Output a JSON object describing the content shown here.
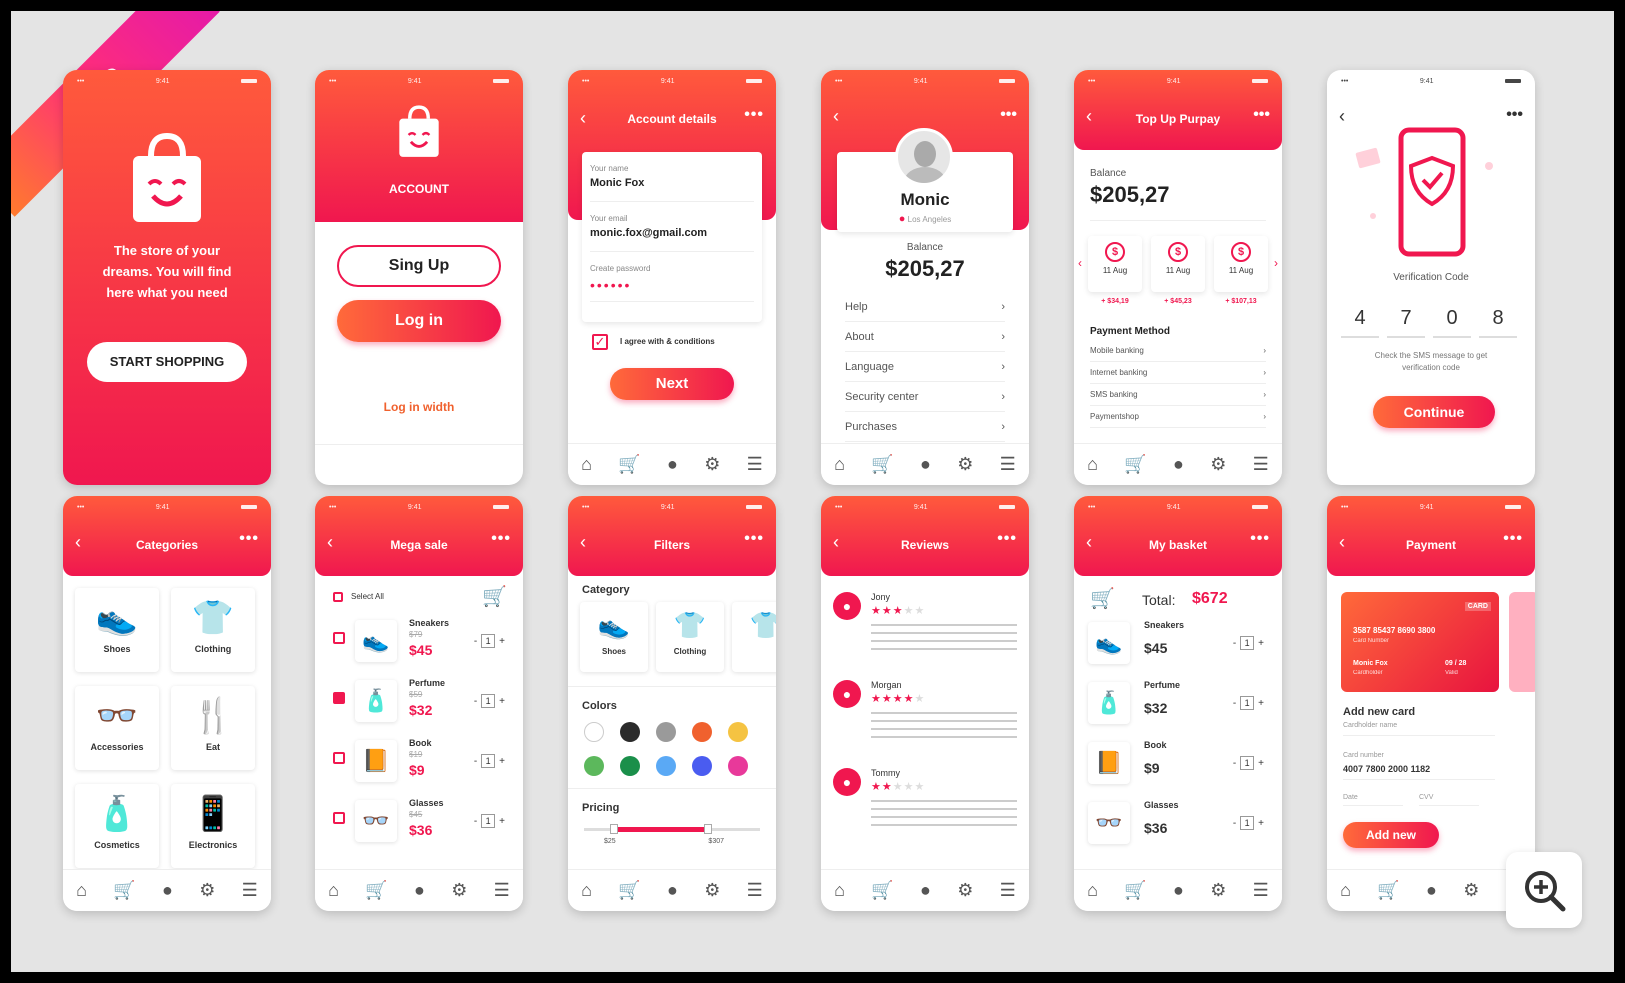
{
  "ribbon": "Pro",
  "nav_icons": [
    "store-icon",
    "cart-icon",
    "user-icon",
    "gear-icon",
    "menu-icon"
  ],
  "welcome": {
    "tagline": "The store of your dreams. You will find here what you need",
    "start_button": "START SHOPPING"
  },
  "account": {
    "title": "ACCOUNT",
    "signup_button": "Sing Up",
    "login_button": "Log in",
    "login_with": "Log in width"
  },
  "account_details": {
    "title": "Account details",
    "name_label": "Your name",
    "name_value": "Monic Fox",
    "email_label": "Your email",
    "email_value": "monic.fox@gmail.com",
    "password_label": "Create password",
    "password_value": "••••••",
    "agree_text": "I agree with & conditions",
    "next_button": "Next"
  },
  "profile": {
    "name": "Monic",
    "location": "Los Angeles",
    "balance_label": "Balance",
    "balance_value": "$205,27",
    "menu": [
      "Help",
      "About",
      "Language",
      "Security center",
      "Purchases"
    ]
  },
  "topup": {
    "title": "Top Up Purpay",
    "balance_label": "Balance",
    "balance_value": "$205,27",
    "coins": [
      {
        "date": "11 Aug",
        "amount": "+ $34,19"
      },
      {
        "date": "11 Aug",
        "amount": "+ $45,23"
      },
      {
        "date": "11 Aug",
        "amount": "+ $107,13"
      }
    ],
    "payment_method_label": "Payment Method",
    "methods": [
      "Mobile banking",
      "Internet banking",
      "SMS banking",
      "Paymentshop"
    ]
  },
  "verify": {
    "label": "Verification Code",
    "digits": [
      "4",
      "7",
      "0",
      "8"
    ],
    "hint": "Check the SMS message to get verification code",
    "continue_button": "Continue"
  },
  "categories": {
    "title": "Categories",
    "items": [
      "Shoes",
      "Clothing",
      "Accessories",
      "Eat",
      "Cosmetics",
      "Electronics"
    ]
  },
  "mega_sale": {
    "title": "Mega sale",
    "select_all": "Select All",
    "products": [
      {
        "name": "Sneakers",
        "old": "$79",
        "price": "$45",
        "qty": "1",
        "checked": false
      },
      {
        "name": "Perfume",
        "old": "$59",
        "price": "$32",
        "qty": "1",
        "checked": true
      },
      {
        "name": "Book",
        "old": "$19",
        "price": "$9",
        "qty": "1",
        "checked": false
      },
      {
        "name": "Glasses",
        "old": "$45",
        "price": "$36",
        "qty": "1",
        "checked": false
      }
    ]
  },
  "filters": {
    "title": "Filters",
    "category_label": "Category",
    "categories": [
      "Shoes",
      "Clothing"
    ],
    "colors_label": "Colors",
    "colors": [
      "#ffffff",
      "#2b2b2b",
      "#9a9a9a",
      "#f0612e",
      "#f5c342",
      "#5cb85c",
      "#1a8f4a",
      "#5aa9f5",
      "#4a5cf0",
      "#e8399a"
    ],
    "pricing_label": "Pricing",
    "price_min": "$25",
    "price_max": "$307"
  },
  "reviews": {
    "title": "Reviews",
    "items": [
      {
        "name": "Jony",
        "stars": 3
      },
      {
        "name": "Morgan",
        "stars": 4
      },
      {
        "name": "Tommy",
        "stars": 2
      }
    ]
  },
  "basket": {
    "title": "My basket",
    "total_label": "Total:",
    "total_value": "$672",
    "products": [
      {
        "name": "Sneakers",
        "price": "$45",
        "qty": "1"
      },
      {
        "name": "Perfume",
        "price": "$32",
        "qty": "1"
      },
      {
        "name": "Book",
        "price": "$9",
        "qty": "1"
      },
      {
        "name": "Glasses",
        "price": "$36",
        "qty": "1"
      }
    ]
  },
  "payment": {
    "title": "Payment",
    "card_brand": "CARD",
    "card_number": "3587 85437 8690 3800",
    "card_number_label": "Card Number",
    "card_holder": "Monic Fox",
    "card_holder_label": "Cardholder",
    "card_expiry": "09 / 28",
    "card_expiry_label": "Valid",
    "add_card_label": "Add new card",
    "cardholder_name_label": "Cardholder name",
    "card_number_field_label": "Card number",
    "card_number_field_value": "4007 7800 2000 1182",
    "date_label": "Date",
    "cvv_label": "CVV",
    "add_button": "Add new"
  }
}
